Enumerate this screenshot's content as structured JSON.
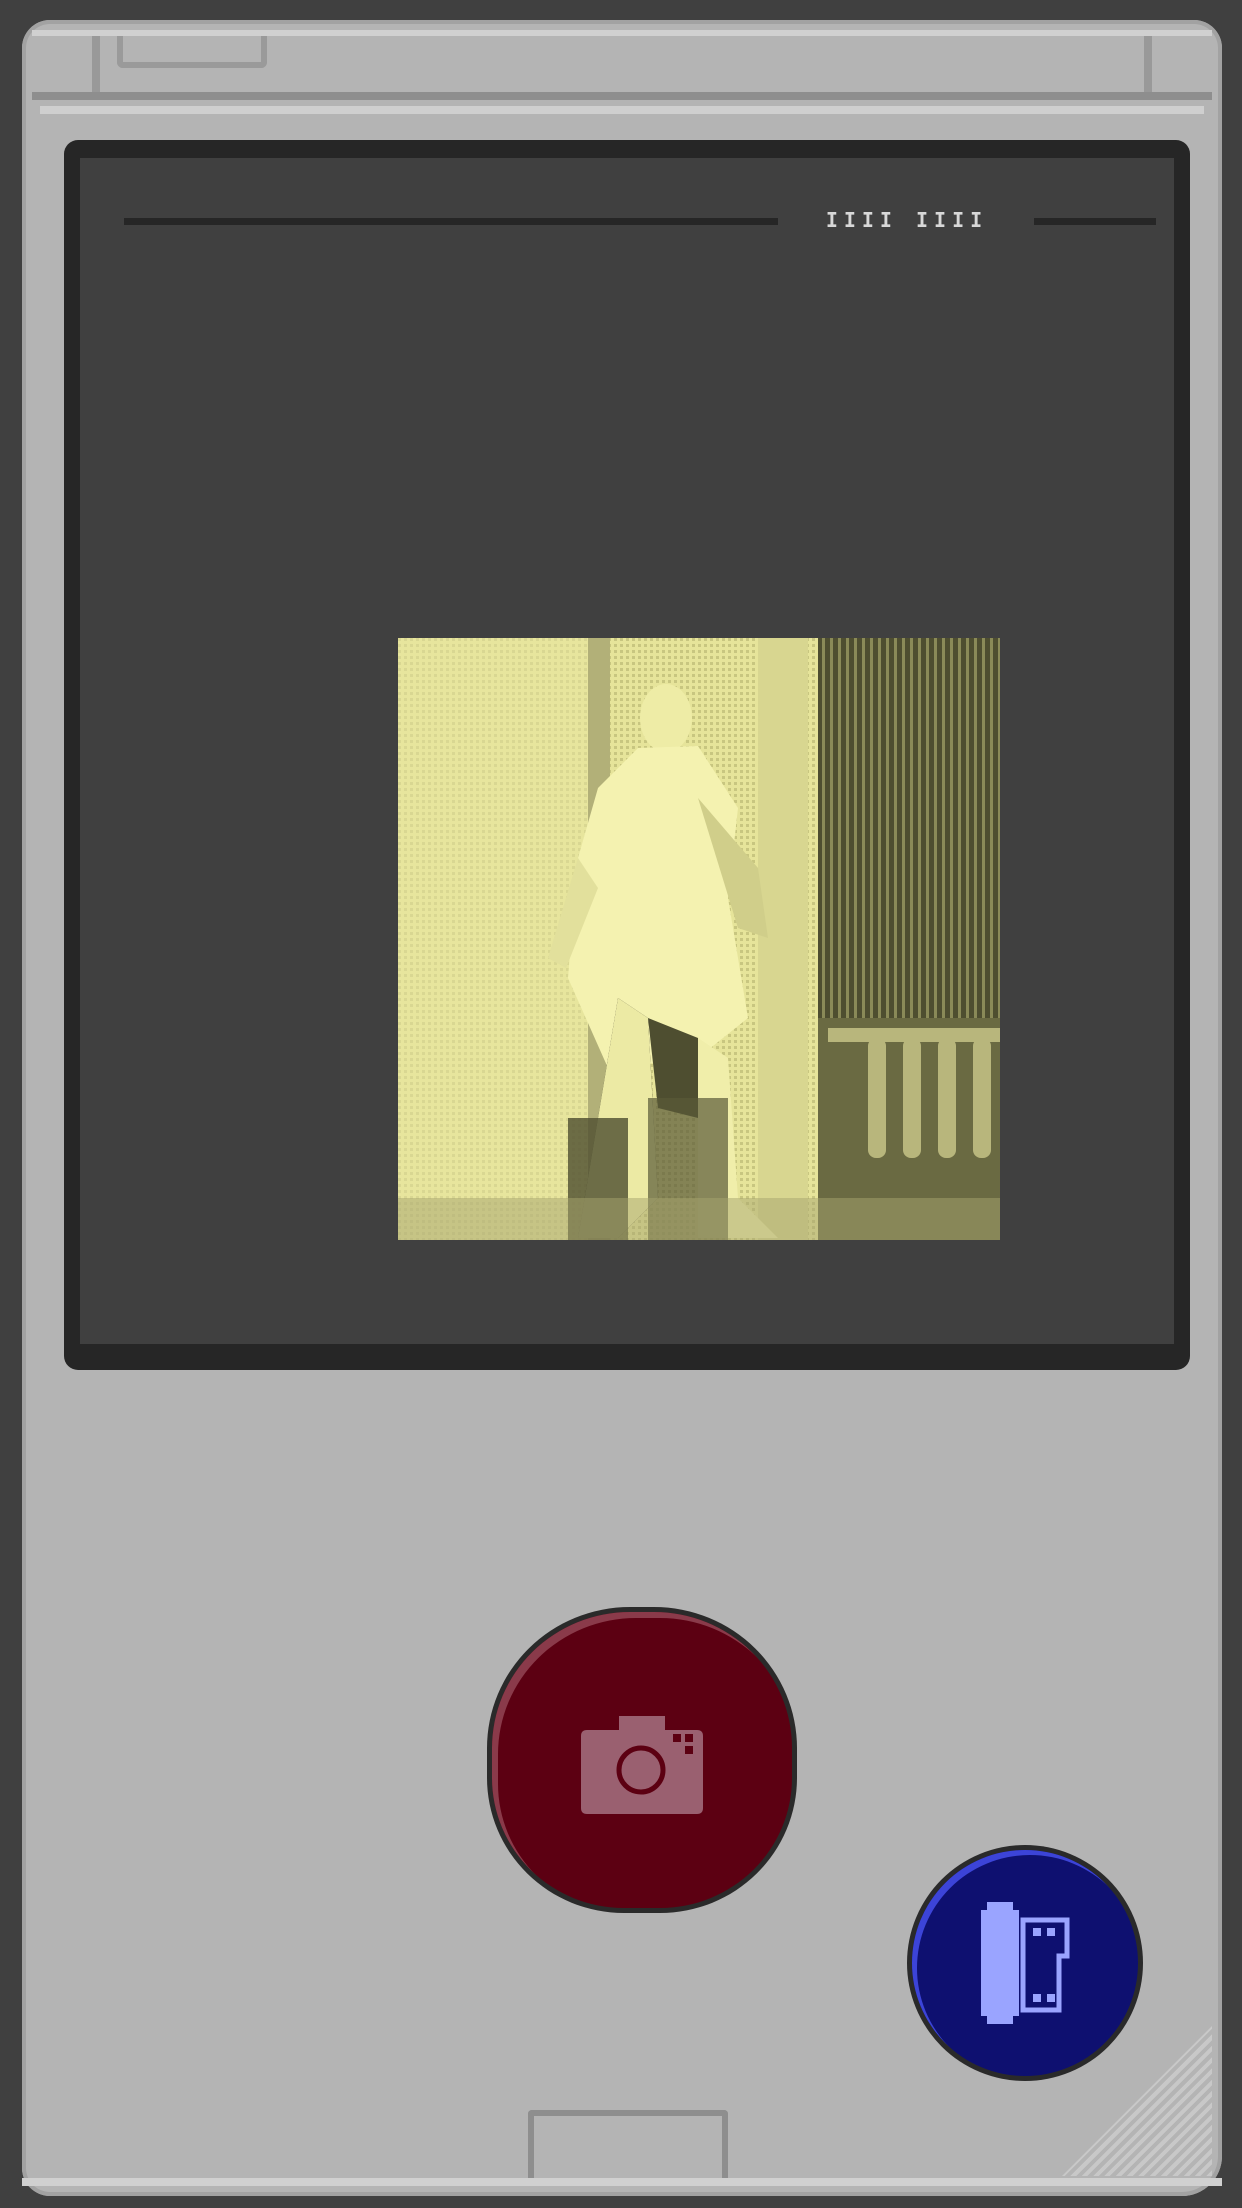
{
  "screen": {
    "label": "IIII IIII"
  },
  "buttons": {
    "shutter": {
      "icon": "camera-icon",
      "color": "#5c0012"
    },
    "film": {
      "icon": "film-roll-icon",
      "color": "#0e1070"
    }
  },
  "palette": {
    "body": "#b4b4b4",
    "screen": "#404040",
    "photo_light": "#f2f0a8",
    "photo_dark": "#4e4e30"
  }
}
